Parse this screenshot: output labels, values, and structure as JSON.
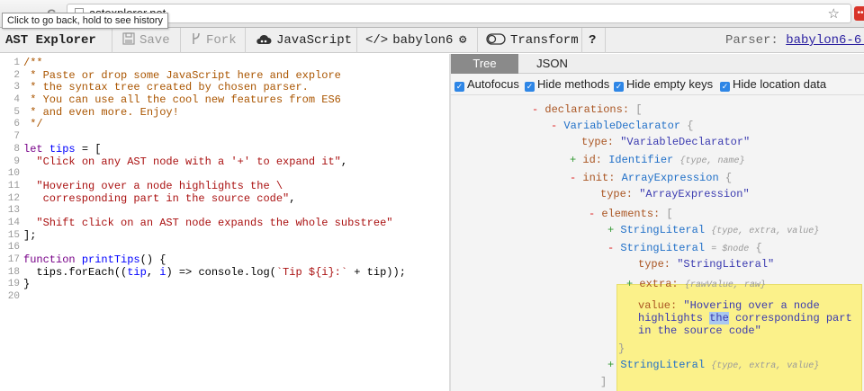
{
  "browser": {
    "url": "astexplorer.net",
    "tooltip": "Click to go back, hold to see history",
    "back_glyph": "←",
    "forward_glyph": "→",
    "reload_glyph": "C",
    "star_glyph": "☆"
  },
  "toolbar": {
    "brand": "AST Explorer",
    "save_label": "Save",
    "fork_label": "Fork",
    "language_label": "JavaScript",
    "parser_button_label": "babylon6",
    "transform_label": "Transform",
    "help_label": "?",
    "parser_label": "Parser:",
    "parser_link": "babylon6-6."
  },
  "editor": {
    "line_numbers": [
      "1",
      "2",
      "3",
      "4",
      "5",
      "6",
      "7",
      "8",
      "9",
      "10",
      "11",
      "12",
      "13",
      "14",
      "15",
      "16",
      "17",
      "18",
      "19",
      "20"
    ]
  },
  "panel": {
    "tabs": [
      "Tree",
      "JSON"
    ],
    "options": [
      "Autofocus",
      "Hide methods",
      "Hide empty keys",
      "Hide location data"
    ],
    "check_glyph": "✓"
  },
  "tree": {
    "minus": "-",
    "plus": "+",
    "declarations_key": "declarations:",
    "open_bracket": "[",
    "close_bracket": "]",
    "open_brace": "{",
    "close_brace": "}",
    "variable_declarator": "VariableDeclarator",
    "type_key": "type:",
    "variable_declarator_type": "\"VariableDeclarator\"",
    "id_key": "id:",
    "identifier": "Identifier",
    "identifier_summary": "{type, name}",
    "init_key": "init:",
    "array_expression": "ArrayExpression",
    "array_expression_type": "\"ArrayExpression\"",
    "elements_key": "elements:",
    "string_literal": "StringLiteral",
    "string_literal_summary": "{type, extra, value}",
    "node_ref": "= $node",
    "string_literal_type": "\"StringLiteral\"",
    "extra_key": "extra:",
    "extra_summary": "{rawValue, raw}",
    "value_key": "value:",
    "value_line1": "\"Hovering over a node",
    "value_line2_pre": "highlights ",
    "value_line2_sel": "the",
    "value_line2_post": " corresponding part",
    "value_line3": "in the source code\""
  }
}
